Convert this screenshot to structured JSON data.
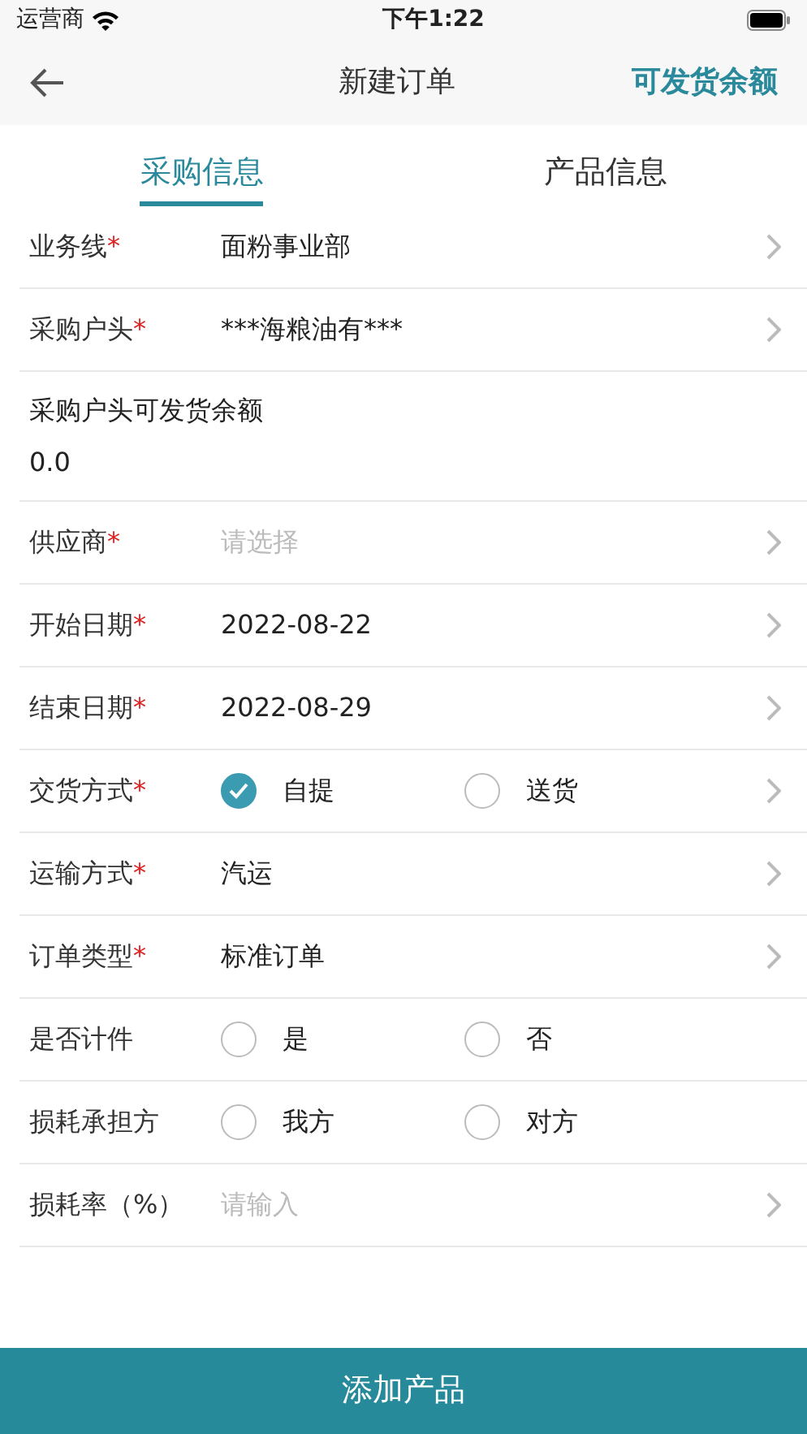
{
  "status_bar": {
    "carrier": "运营商",
    "time": "下午1:22"
  },
  "nav": {
    "title": "新建订单",
    "action": "可发货余额"
  },
  "tabs": [
    {
      "label": "采购信息",
      "selected": true
    },
    {
      "label": "产品信息",
      "selected": false
    }
  ],
  "fields": [
    {
      "kind": "select",
      "label": "业务线",
      "required_mark": "*",
      "value": "面粉事业部",
      "chevron": true
    },
    {
      "kind": "select",
      "label": "采购户头",
      "required_mark": "*",
      "value": "***海粮油有***",
      "chevron": true
    },
    {
      "kind": "info",
      "label": "采购户头可发货余额",
      "value": "0.0",
      "chevron": false
    },
    {
      "kind": "select",
      "label": "供应商",
      "required_mark": "*",
      "placeholder": "请选择",
      "chevron": true
    },
    {
      "kind": "select",
      "label": "开始日期",
      "required_mark": "*",
      "value": "2022-08-22",
      "chevron": true
    },
    {
      "kind": "select",
      "label": "结束日期",
      "required_mark": "*",
      "value": "2022-08-29",
      "chevron": true
    },
    {
      "kind": "radio",
      "label": "交货方式",
      "required_mark": "*",
      "options": [
        {
          "label": "自提",
          "selected": true
        },
        {
          "label": "送货",
          "selected": false
        }
      ],
      "chevron": true
    },
    {
      "kind": "select",
      "label": "运输方式",
      "required_mark": "*",
      "value": "汽运",
      "chevron": true
    },
    {
      "kind": "select",
      "label": "订单类型",
      "required_mark": "*",
      "value": "标准订单",
      "chevron": true
    },
    {
      "kind": "radio",
      "label": "是否计件",
      "options": [
        {
          "label": "是",
          "selected": false
        },
        {
          "label": "否",
          "selected": false
        }
      ],
      "chevron": false
    },
    {
      "kind": "radio",
      "label": "损耗承担方",
      "options": [
        {
          "label": "我方",
          "selected": false
        },
        {
          "label": "对方",
          "selected": false
        }
      ],
      "chevron": false
    },
    {
      "kind": "select",
      "label": "损耗率（%）",
      "placeholder": "请输入",
      "chevron": true
    }
  ],
  "footer_button": "添加产品"
}
